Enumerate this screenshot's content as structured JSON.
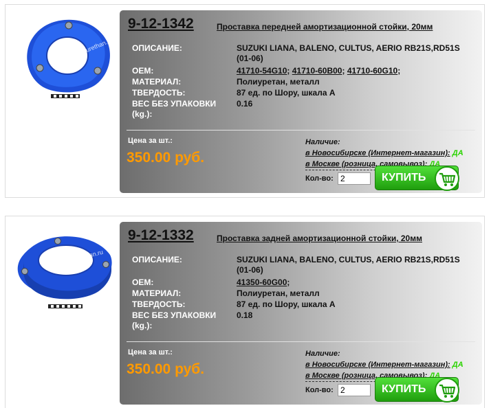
{
  "colors": {
    "price": "#ff9a00",
    "available": "#2bd400",
    "buy_button": "#2fbf1a"
  },
  "products": [
    {
      "sku": "9-12-1342",
      "title": "Проставка передней амортизационной стойки, 20мм",
      "image_watermark": "www.polyurethan.ru",
      "desc_label": "ОПИСАНИЕ:",
      "desc_value": "SUZUKI LIANA, BALENO, CULTUS, AERIO RB21S,RD51S (01-06)",
      "oem_label": "ОЕМ:",
      "oem": [
        "41710-54G10",
        "41710-60B00",
        "41710-60G10"
      ],
      "material_label": "МАТЕРИАЛ:",
      "material_value": "Полиуретан, металл",
      "hardness_label": "ТВЕРДОСТЬ:",
      "hardness_value": "87 ед. по Шору, шкала А",
      "weight_label": "ВЕС БЕЗ УПАКОВКИ (kg.):",
      "weight_value": "0.16",
      "price_label": "Цена за шт.:",
      "price": "350.00 руб.",
      "avail_title": "Наличие:",
      "avail_nsk": "в Новосибирске (Интернет-магазин):",
      "avail_nsk_value": "ДА",
      "avail_msk": "в Москве (розница, самовывоз):",
      "avail_msk_value": "ДА",
      "qty_label": "Кол-во:",
      "qty_value": "2",
      "buy_label": "КУПИТЬ",
      "cart_icon": "shopping-cart-icon"
    },
    {
      "sku": "9-12-1332",
      "title": "Проставка задней амортизационной стойки, 20мм",
      "image_watermark": "www.polyurethan.ru",
      "desc_label": "ОПИСАНИЕ:",
      "desc_value": "SUZUKI LIANA, BALENO, CULTUS, AERIO RB21S,RD51S (01-06)",
      "oem_label": "ОЕМ:",
      "oem": [
        "41350-60G00"
      ],
      "material_label": "МАТЕРИАЛ:",
      "material_value": "Полиуретан, металл",
      "hardness_label": "ТВЕРДОСТЬ:",
      "hardness_value": "87 ед. по Шору, шкала А",
      "weight_label": "ВЕС БЕЗ УПАКОВКИ (kg.):",
      "weight_value": "0.18",
      "price_label": "Цена за шт.:",
      "price": "350.00 руб.",
      "avail_title": "Наличие:",
      "avail_nsk": "в Новосибирске (Интернет-магазин):",
      "avail_nsk_value": "ДА",
      "avail_msk": "в Москве (розница, самовывоз):",
      "avail_msk_value": "ДА",
      "qty_label": "Кол-во:",
      "qty_value": "2",
      "buy_label": "КУПИТЬ",
      "cart_icon": "shopping-cart-icon"
    }
  ]
}
